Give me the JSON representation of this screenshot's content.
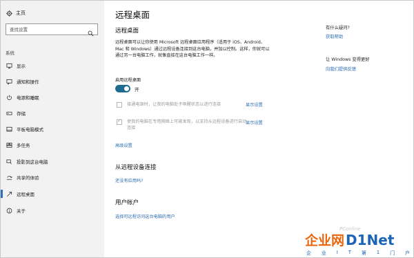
{
  "sidebar": {
    "home_label": "主页",
    "search_placeholder": "查找设置",
    "section_label": "系统",
    "items": [
      {
        "label": "显示"
      },
      {
        "label": "通知和操作"
      },
      {
        "label": "电源和睡眠"
      },
      {
        "label": "存储"
      },
      {
        "label": "平板电脑模式"
      },
      {
        "label": "多任务"
      },
      {
        "label": "投影到这台电脑"
      },
      {
        "label": "共享的体验"
      },
      {
        "label": "远程桌面"
      },
      {
        "label": "关于"
      }
    ],
    "active_item": "远程桌面"
  },
  "main": {
    "page_title": "远程桌面",
    "section_title": "远程桌面",
    "description": "远程桌面可以让你使用 Microsoft 远程桌面应用程序（适用于 iOS、Android、Mac 和 Windows）通过远程设备连接到这台电脑，并加以控制。这样，你就可以通过另一台电脑工作，就像直接在这台电脑工作一样。",
    "enable_label": "启用远程桌面",
    "toggle_state": "开",
    "checkbox1_text": "接通电源时，让我的电脑处于唤醒状态以进行连接",
    "checkbox1_link": "显示设置",
    "checkbox2_text": "使我的电脑在专用网络上可被发现，以支持从远程设备进行自动连接",
    "checkbox2_link": "显示设置",
    "advanced_link": "高级设置",
    "connect_title": "从远程设备连接",
    "connect_link": "还没有应用吗?",
    "accounts_title": "用户帐户",
    "accounts_link": "选择可远程访问这台电脑的用户"
  },
  "right": {
    "question_head": "有什么疑问?",
    "help_link": "获取帮助",
    "improve_head": "让 Windows 变得更好",
    "feedback_link": "向我们提供反馈"
  },
  "watermark": {
    "pcc": "PConline",
    "logo_cn": "企业网",
    "logo_en": "D1Net",
    "sub": [
      "企",
      "业",
      "I",
      "T",
      "第",
      "1",
      "门",
      "户"
    ]
  },
  "colors": {
    "accent": "#2f6fb5",
    "toggle_on": "#1f6a8f",
    "sidebar_bg": "#f2f2f2",
    "logo_orange": "#e8670d",
    "logo_blue": "#1b64b7"
  }
}
